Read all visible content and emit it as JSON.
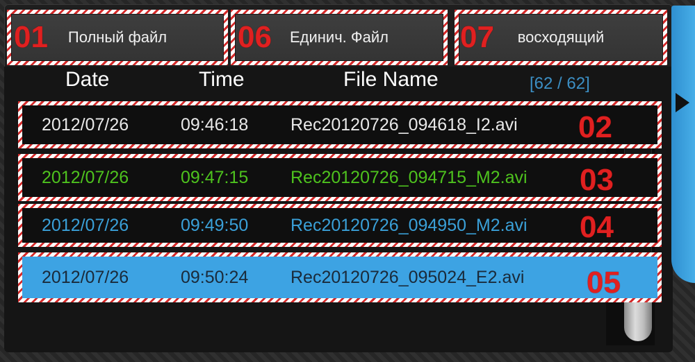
{
  "buttons": {
    "full_file": "Полный файл",
    "single_file": "Единич. Файл",
    "ascending": "восходящий"
  },
  "annotations": {
    "n01": "01",
    "n02": "02",
    "n03": "03",
    "n04": "04",
    "n05": "05",
    "n06": "06",
    "n07": "07"
  },
  "table": {
    "headers": {
      "date": "Date",
      "time": "Time",
      "file_name": "File Name"
    },
    "counter": "[62 / 62]",
    "rows": [
      {
        "date": "2012/07/26",
        "time": "09:46:18",
        "file": "Rec20120726_094618_I2.avi",
        "color": "#e8e8e8"
      },
      {
        "date": "2012/07/26",
        "time": "09:47:15",
        "file": "Rec20120726_094715_M2.avi",
        "color": "#4ec21e"
      },
      {
        "date": "2012/07/26",
        "time": "09:49:50",
        "file": "Rec20120726_094950_M2.avi",
        "color": "#3aa0d8"
      },
      {
        "date": "2012/07/26",
        "time": "09:50:24",
        "file": "Rec20120726_095024_E2.avi",
        "color": "#1a2a3a"
      }
    ]
  },
  "colors": {
    "selected_row_bg": "#3da3e3",
    "row_bg": "#0f0f0f",
    "annotation_red": "#e02020",
    "accent_blue": "#3c8fc4"
  },
  "icons": {
    "expand_tab": "triangle-right-icon"
  }
}
